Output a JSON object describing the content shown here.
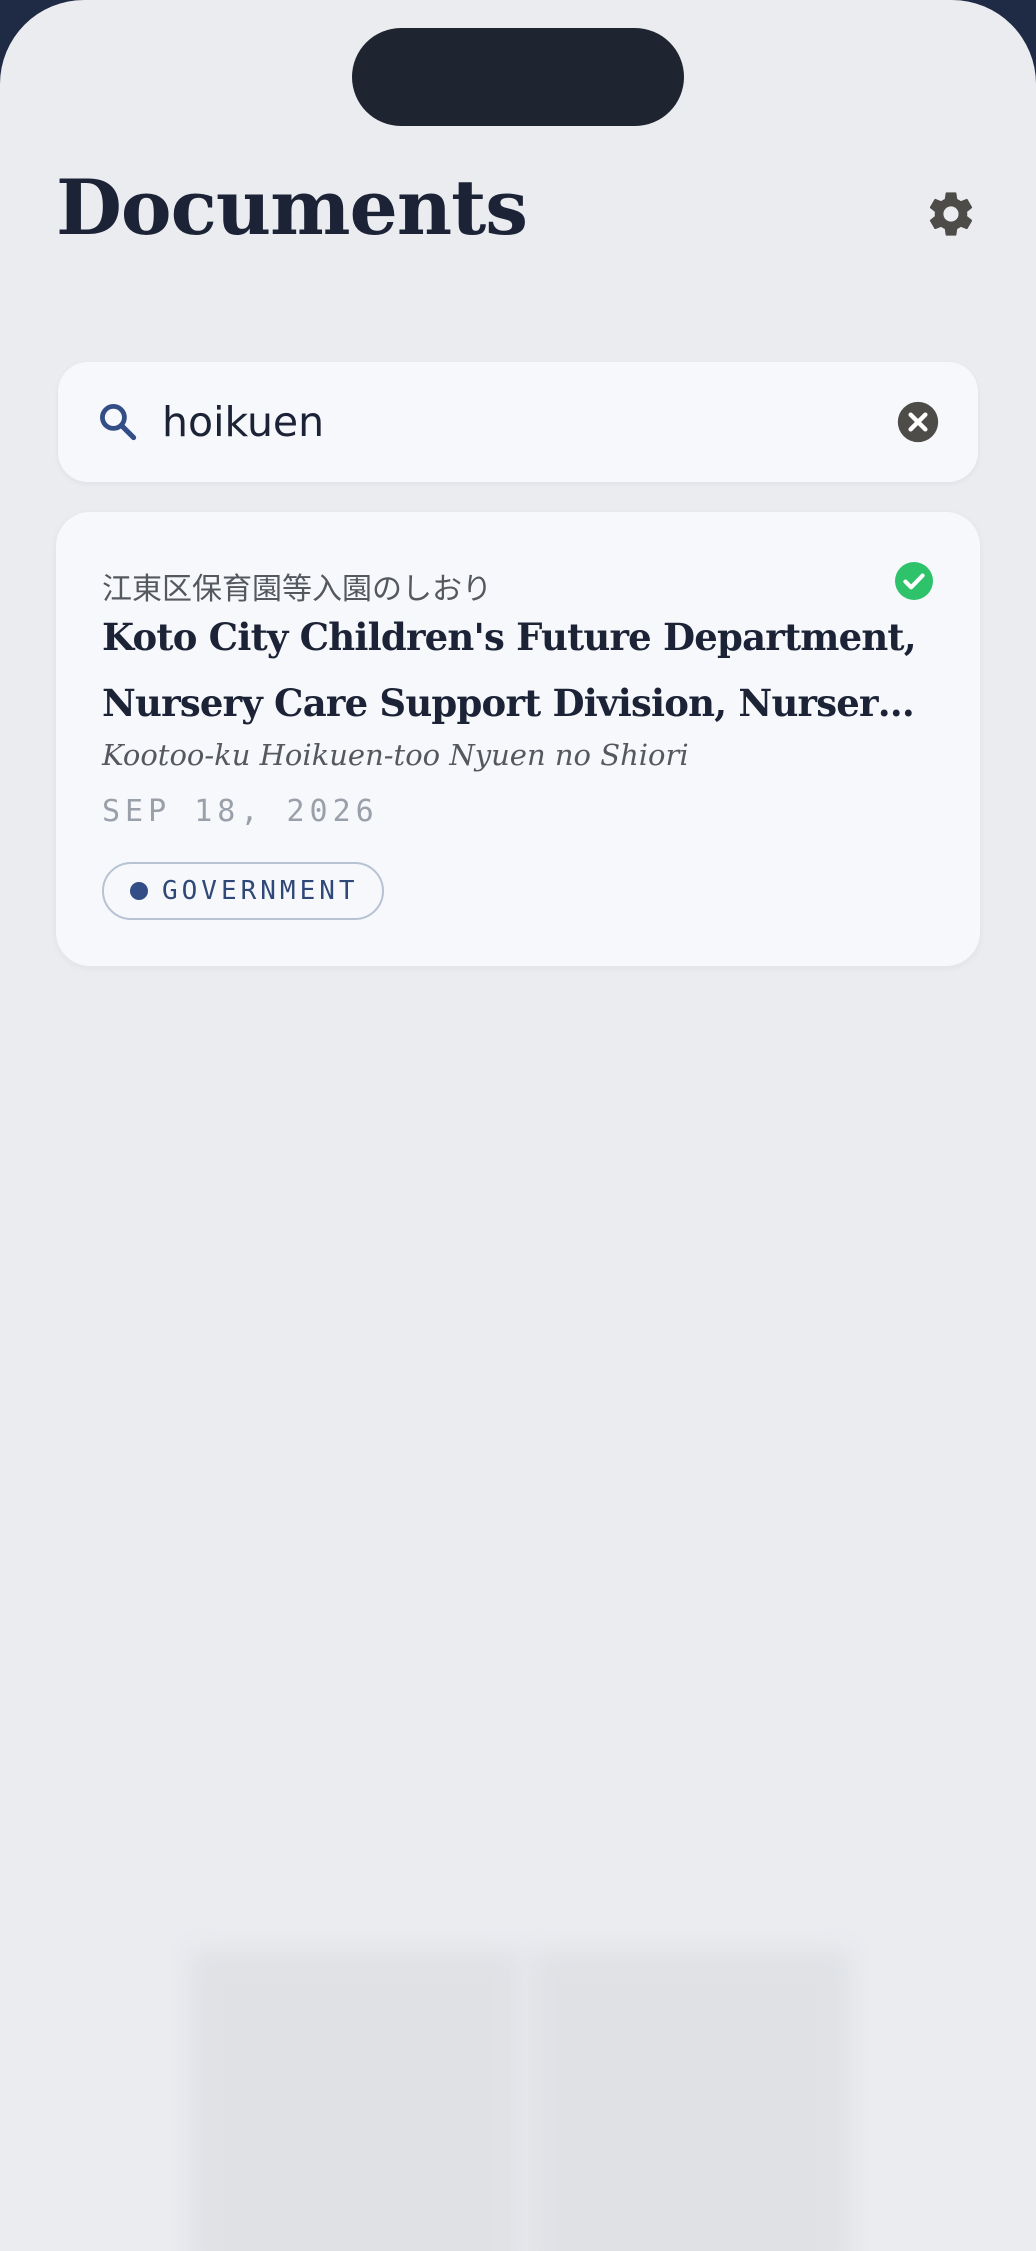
{
  "header": {
    "title": "Documents"
  },
  "search": {
    "value": "hoikuen"
  },
  "results": [
    {
      "jp_title": "江東区保育園等入園のしおり",
      "en_title": "Koto City Children's Future Department, Nursery Care Support Division, Nursery Enrollment Guide",
      "romaji": "Kootoo-ku Hoikuen-too Nyuen no Shiori",
      "date": "SEP 18, 2026",
      "tag": "GOVERNMENT",
      "status": "verified"
    }
  ],
  "icons": {
    "settings": "gear-icon",
    "search": "search-icon",
    "clear": "clear-icon",
    "status": "check-circle-icon"
  },
  "colors": {
    "background": "#eaecf0",
    "card": "#f6f8fb",
    "title": "#1c2336",
    "accent": "#334e86",
    "verified": "#2ec26a"
  }
}
